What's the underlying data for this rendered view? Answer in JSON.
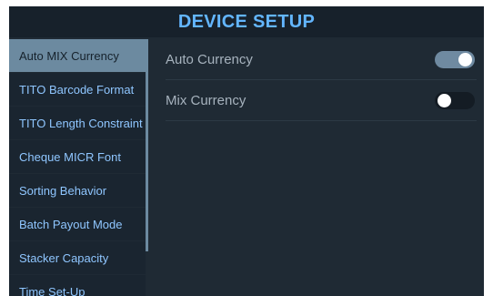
{
  "header": {
    "title": "DEVICE SETUP"
  },
  "sidebar": {
    "items": [
      {
        "label": "Auto MIX Currency"
      },
      {
        "label": "TITO Barcode Format"
      },
      {
        "label": "TITO Length Constraint"
      },
      {
        "label": "Cheque MICR Font"
      },
      {
        "label": "Sorting Behavior"
      },
      {
        "label": "Batch Payout Mode"
      },
      {
        "label": "Stacker Capacity"
      },
      {
        "label": "Time Set-Up"
      }
    ],
    "active_index": 0
  },
  "settings": [
    {
      "label": "Auto Currency",
      "state": "on"
    },
    {
      "label": "Mix Currency",
      "state": "off"
    }
  ],
  "colors": {
    "accent_title": "#63b6ff",
    "active_item_bg": "#6c8aa0",
    "toggle_on": "#6f8aa1",
    "toggle_off": "#141c24"
  }
}
